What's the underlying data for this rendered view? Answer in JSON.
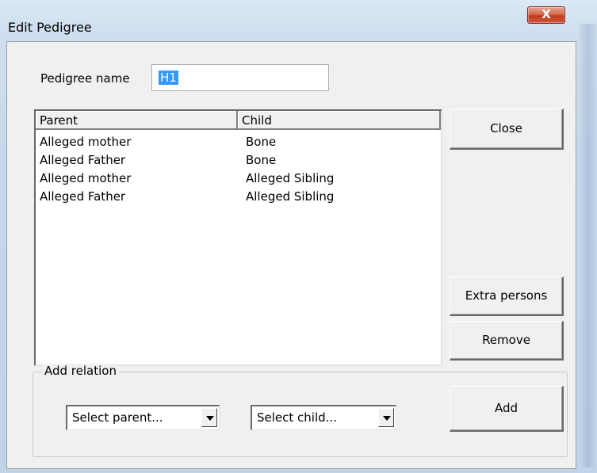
{
  "window": {
    "title": "Edit Pedigree",
    "close_glyph": "X"
  },
  "form": {
    "name_label": "Pedigree name",
    "name_value": "H1"
  },
  "list": {
    "columns": [
      "Parent",
      "Child"
    ],
    "rows": [
      {
        "parent": "Alleged mother",
        "child": "Bone"
      },
      {
        "parent": "Alleged Father",
        "child": "Bone"
      },
      {
        "parent": "Alleged mother",
        "child": "Alleged Sibling"
      },
      {
        "parent": "Alleged Father",
        "child": "Alleged Sibling"
      }
    ]
  },
  "buttons": {
    "close": "Close",
    "extra_persons": "Extra persons",
    "remove": "Remove",
    "add": "Add"
  },
  "add_relation": {
    "group_label": "Add relation",
    "parent_select": "Select parent...",
    "child_select": "Select child..."
  },
  "colors": {
    "close_button": "#c4452a",
    "selection": "#3399ff"
  }
}
